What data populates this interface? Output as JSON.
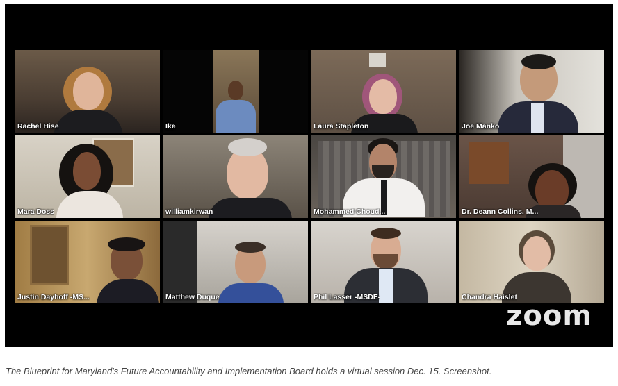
{
  "participants": [
    {
      "name": "Rachel Hise"
    },
    {
      "name": "Ike"
    },
    {
      "name": "Laura Stapleton"
    },
    {
      "name": "Joe Manko"
    },
    {
      "name": "Mara Doss"
    },
    {
      "name": "williamkirwan"
    },
    {
      "name": "Mohammed Choud..."
    },
    {
      "name": "Dr. Deann Collins, M..."
    },
    {
      "name": "Justin Dayhoff -MS..."
    },
    {
      "name": "Matthew Duque"
    },
    {
      "name": "Phil Lasser -MSDE-"
    },
    {
      "name": "Chandra Haislet"
    }
  ],
  "active_speaker_color": "#3fce3f",
  "app_logo": "zoom",
  "caption": "The Blueprint for Maryland's Future Accountability and Implementation Board holds a virtual session Dec. 15. Screenshot."
}
